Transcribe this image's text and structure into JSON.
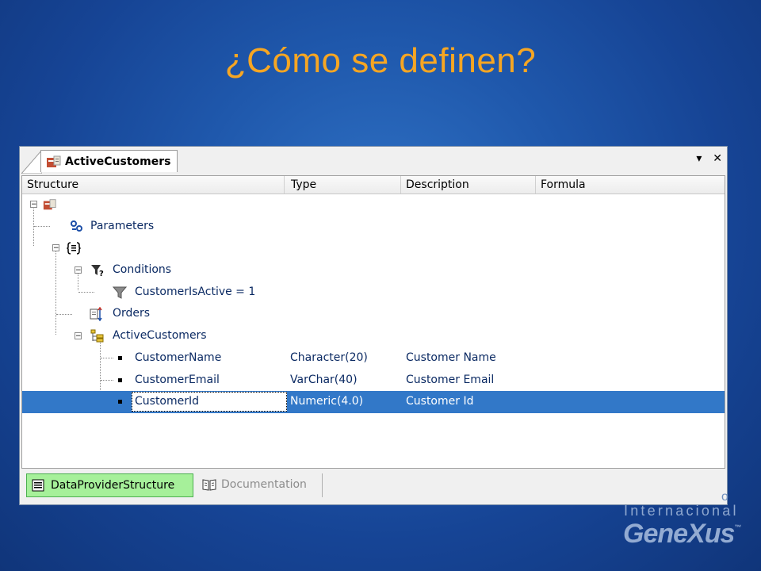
{
  "slide": {
    "title": "¿Cómo se definen?"
  },
  "window": {
    "tab_title": "ActiveCustomers",
    "controls": {
      "pin": "▾",
      "close": "✕"
    },
    "columns": [
      "Structure",
      "Type",
      "Description",
      "Formula"
    ],
    "rows": [
      {
        "label": "",
        "type": "",
        "description": "",
        "icon": "dataprovider-icon",
        "depth": 0,
        "expander": "minus"
      },
      {
        "label": "Parameters",
        "type": "",
        "description": "",
        "icon": "parameters-icon",
        "depth": 1,
        "expander": ""
      },
      {
        "label": "",
        "type": "",
        "description": "",
        "icon": "group-icon",
        "depth": 1,
        "expander": "minus"
      },
      {
        "label": "Conditions",
        "type": "",
        "description": "",
        "icon": "conditions-icon",
        "depth": 2,
        "expander": "minus"
      },
      {
        "label": "CustomerIsActive = 1",
        "type": "",
        "description": "",
        "icon": "filter-icon",
        "depth": 3,
        "expander": ""
      },
      {
        "label": "Orders",
        "type": "",
        "description": "",
        "icon": "orders-icon",
        "depth": 2,
        "expander": ""
      },
      {
        "label": "ActiveCustomers",
        "type": "",
        "description": "",
        "icon": "collection-icon",
        "depth": 2,
        "expander": "minus"
      },
      {
        "label": "CustomerName",
        "type": "Character(20)",
        "description": "Customer Name",
        "icon": "bullet-icon",
        "depth": 3,
        "expander": ""
      },
      {
        "label": "CustomerEmail",
        "type": "VarChar(40)",
        "description": "Customer Email",
        "icon": "bullet-icon",
        "depth": 3,
        "expander": ""
      },
      {
        "label": "CustomerId",
        "type": "Numeric(4.0)",
        "description": "Customer Id",
        "icon": "bullet-icon",
        "depth": 3,
        "expander": "",
        "selected": true
      }
    ],
    "bottom_tabs": [
      {
        "label": "DataProviderStructure",
        "active": true,
        "icon": "structure-icon"
      },
      {
        "label": "Documentation",
        "active": false,
        "icon": "book-icon"
      }
    ],
    "colors": {
      "selection": "#3278c8",
      "active_tab": "#a6f09a",
      "title": "#f6a623"
    }
  },
  "logo": {
    "line1": "o",
    "line2": "Internacional",
    "brand": "GeneXus"
  }
}
